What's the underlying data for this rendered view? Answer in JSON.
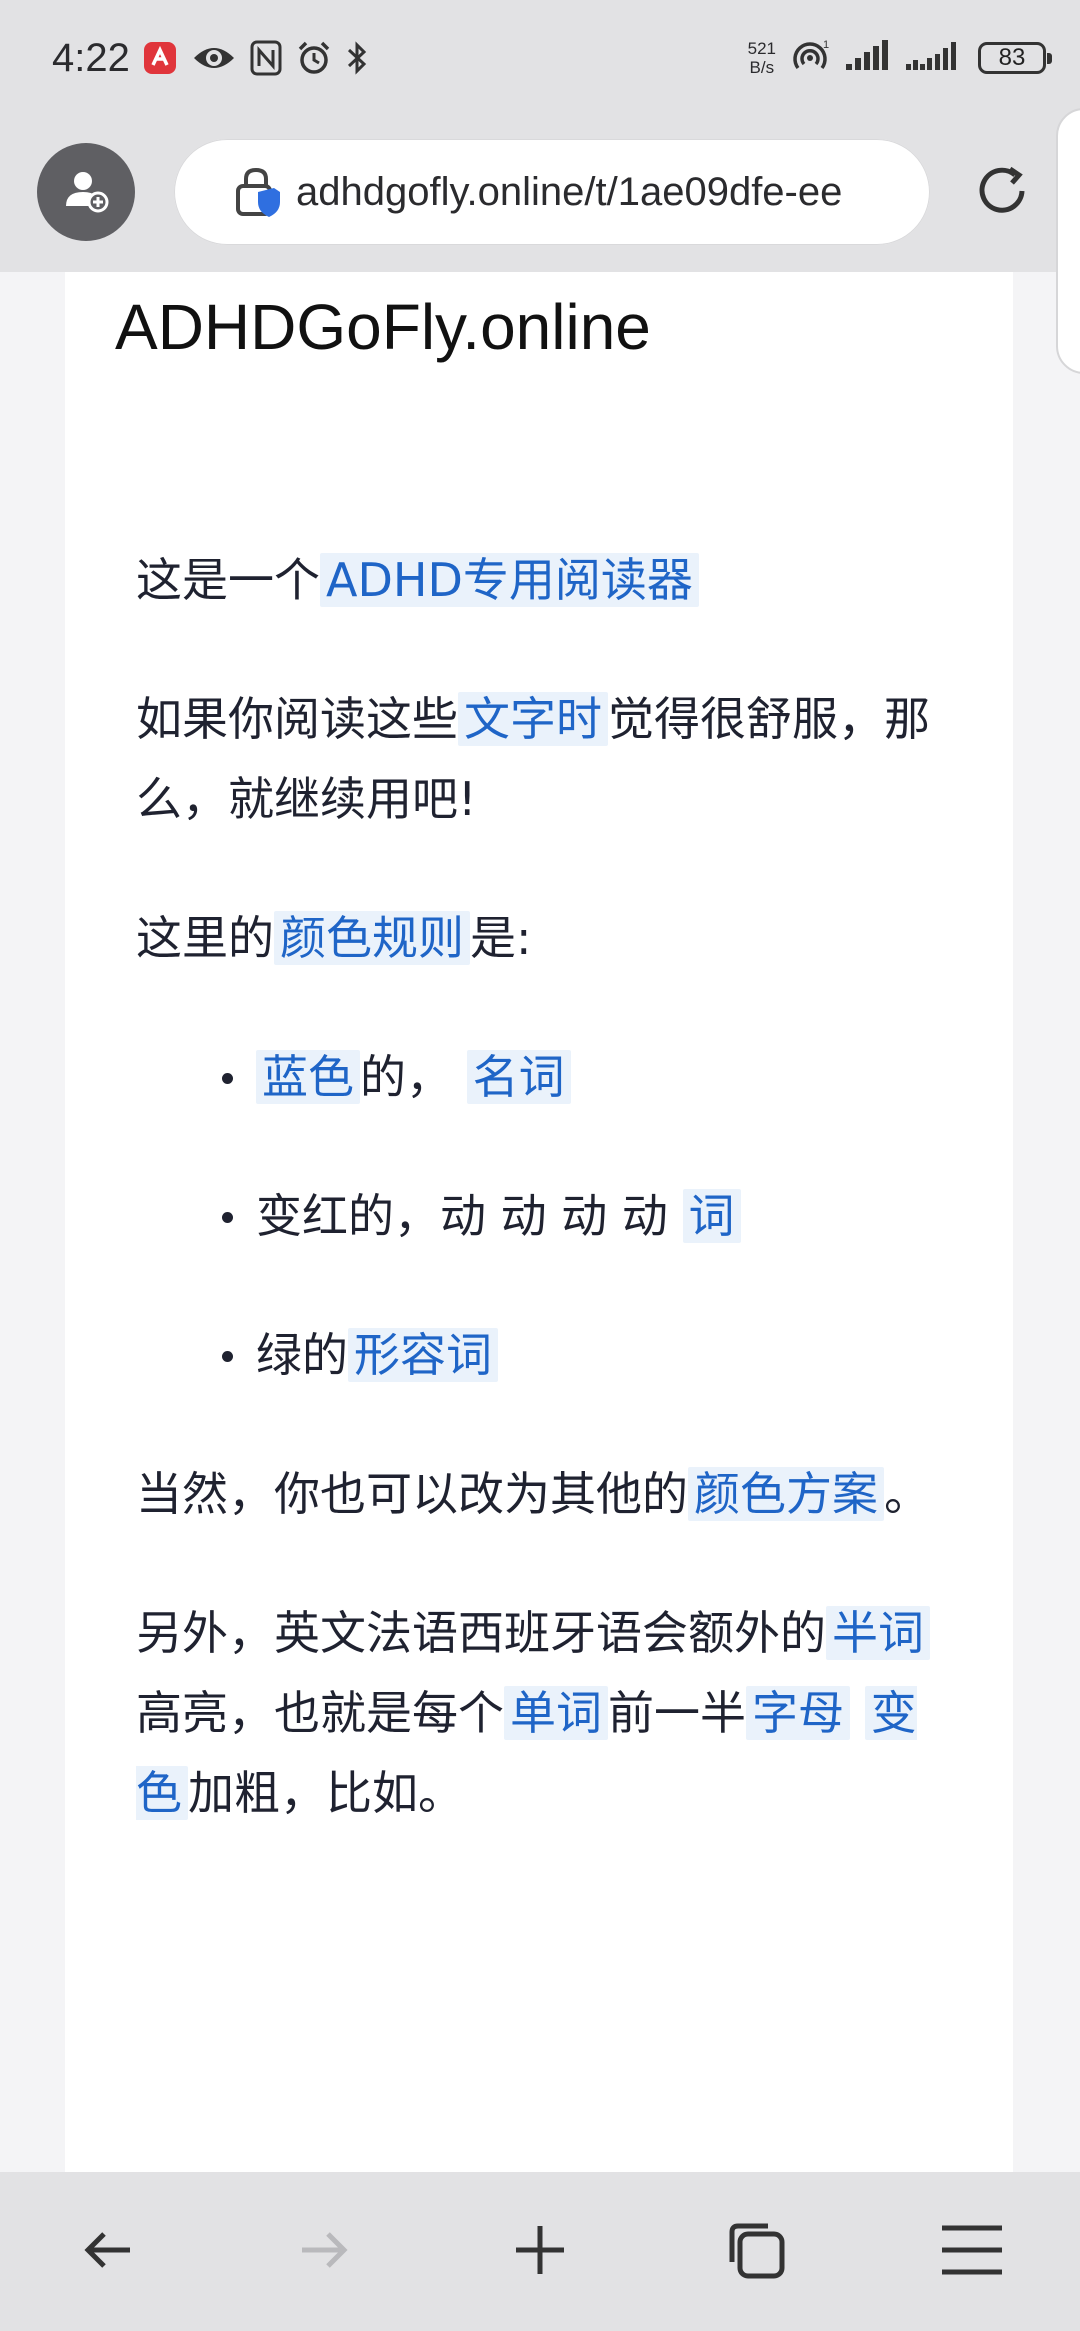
{
  "status_bar": {
    "time": "4:22",
    "net_speed_value": "521",
    "net_speed_unit": "B/s",
    "battery": "83"
  },
  "browser": {
    "url": "adhdgofly.online/t/1ae09dfe-ee"
  },
  "page": {
    "site_title": "ADHDGoFly.online",
    "p1": {
      "t1": "这是一个",
      "h1": "ADHD专用阅读器"
    },
    "p2": {
      "t1": "如果你阅读这些",
      "h1": "文字时",
      "t2": "觉得很舒服，那么，就继续用吧!"
    },
    "p3": {
      "t1": "这里的",
      "h1": "颜色规则",
      "t2": "是:"
    },
    "list": [
      {
        "h1": "蓝色",
        "t1": "的，",
        "h2": "名词"
      },
      {
        "t1": "变红的，动 动 动 动",
        "h1": "词"
      },
      {
        "t1": "绿的",
        "h1": "形容词"
      }
    ],
    "p4": {
      "t1": "当然，你也可以改为其他的",
      "h1": "颜色方案",
      "t2": "。"
    },
    "p5": {
      "t1": "另外，英文法语西班牙语会额外的",
      "h1": "半词",
      "t2": "高亮，也就是每个",
      "h2": "单词",
      "t3": "前一半",
      "h3": "字母",
      "h4": "变色",
      "t4": "加粗，比如。"
    }
  },
  "icons": {
    "status": [
      "app-notification-icon",
      "eye-icon",
      "nfc-icon",
      "alarm-icon",
      "bluetooth-icon",
      "hotspot-icon",
      "signal-icon",
      "battery-icon"
    ],
    "browser": [
      "profile-add-icon",
      "lock-shield-icon",
      "reload-icon"
    ],
    "nav": [
      "back-arrow-icon",
      "forward-arrow-icon",
      "plus-icon",
      "tabs-icon",
      "menu-icon"
    ]
  },
  "colors": {
    "highlight_text": "#1f65c7",
    "highlight_bg": "#eaf2fb",
    "body_text": "#1f2230",
    "chrome_bg": "#e2e2e4"
  }
}
